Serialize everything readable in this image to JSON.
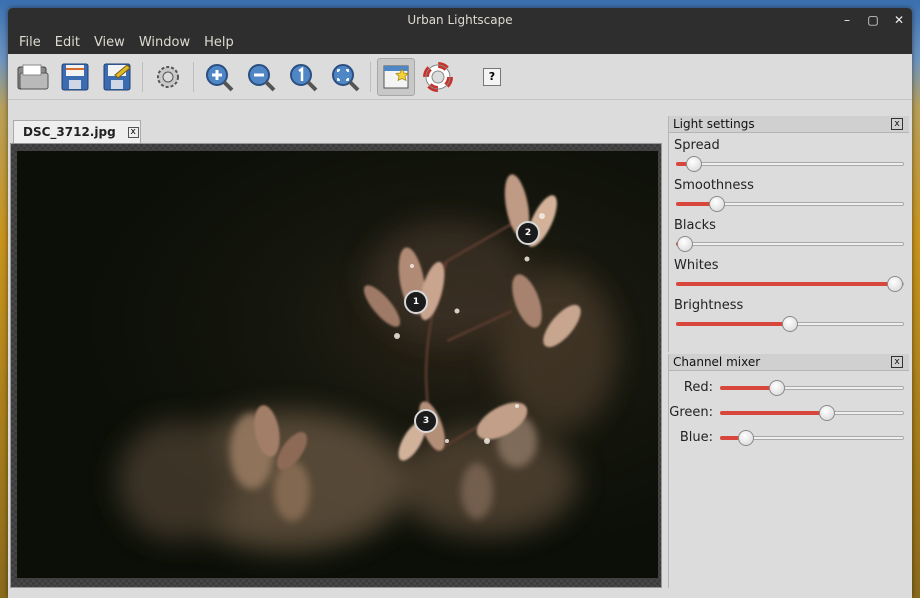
{
  "window": {
    "title": "Urban Lightscape",
    "controls": [
      "–",
      "▢",
      "✕"
    ]
  },
  "menu": [
    "File",
    "Edit",
    "View",
    "Window",
    "Help"
  ],
  "toolbar": {
    "help_label": "?"
  },
  "tab": {
    "label": "DSC_3712.jpg",
    "close": "x"
  },
  "control_points": [
    "1",
    "2",
    "3"
  ],
  "light_settings": {
    "title": "Light settings",
    "close": "x",
    "sliders": [
      {
        "label": "Spread",
        "value": 0.08
      },
      {
        "label": "Smoothness",
        "value": 0.18
      },
      {
        "label": "Blacks",
        "value": 0.04
      },
      {
        "label": "Whites",
        "value": 0.96
      },
      {
        "label": "Brightness",
        "value": 0.5
      }
    ]
  },
  "channel_mixer": {
    "title": "Channel mixer",
    "close": "x",
    "sliders": [
      {
        "label": "Red:",
        "value": 0.31
      },
      {
        "label": "Green:",
        "value": 0.58
      },
      {
        "label": "Blue:",
        "value": 0.14
      }
    ]
  },
  "colors": {
    "accent": "#d9473c",
    "titlebar": "#2e2e2e"
  }
}
